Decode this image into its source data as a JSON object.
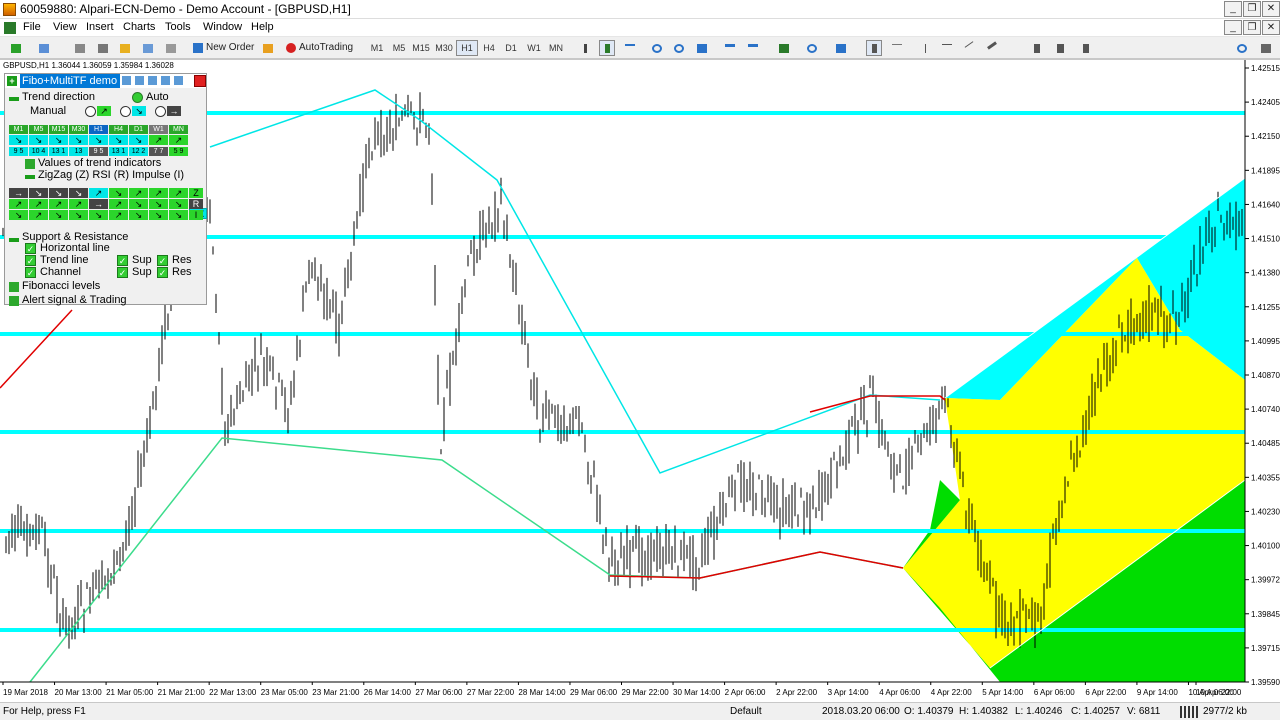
{
  "window": {
    "title": "60059880: Alpari-ECN-Demo - Demo Account - [GBPUSD,H1]"
  },
  "menu": [
    "File",
    "View",
    "Insert",
    "Charts",
    "Tools",
    "Window",
    "Help"
  ],
  "toolbar": {
    "new_order": "New Order",
    "auto_trading": "AutoTrading",
    "timeframes": [
      "M1",
      "M5",
      "M15",
      "M30",
      "H1",
      "H4",
      "D1",
      "W1",
      "MN"
    ],
    "active_timeframe": "H1"
  },
  "chart": {
    "symbol_line": "GBPUSD,H1  1.36044 1.36059 1.35984 1.36028",
    "price_labels": [
      "1.42515",
      "1.42405",
      "1.42150",
      "1.41895",
      "1.41640",
      "1.41510",
      "1.41380",
      "1.41255",
      "1.40995",
      "1.40870",
      "1.40740",
      "1.40485",
      "1.40355",
      "1.40230",
      "1.40100",
      "1.39972",
      "1.39845",
      "1.39715",
      "1.39590"
    ],
    "time_labels": [
      "19 Mar 2018",
      "20 Mar 13:00",
      "21 Mar 05:00",
      "21 Mar 21:00",
      "22 Mar 13:00",
      "23 Mar 05:00",
      "23 Mar 21:00",
      "26 Mar 14:00",
      "27 Mar 06:00",
      "27 Mar 22:00",
      "28 Mar 14:00",
      "29 Mar 06:00",
      "29 Mar 22:00",
      "30 Mar 14:00",
      "2 Apr 06:00",
      "2 Apr 22:00",
      "3 Apr 14:00",
      "4 Apr 06:00",
      "4 Apr 22:00",
      "5 Apr 14:00",
      "6 Apr 06:00",
      "6 Apr 22:00",
      "9 Apr 14:00",
      "10 Apr 06:00",
      "10 Apr 22:00"
    ],
    "colors": {
      "hline": "#00ffff",
      "zigzag": "#00e6e6",
      "support": "#3cdc8c",
      "resistance": "#e00000",
      "yellow": "#ffff00",
      "green": "#00dd00",
      "cyan": "#00ffff"
    }
  },
  "panel": {
    "title": "Fibo+MultiTF demo",
    "trend_direction": "Trend direction",
    "auto": "Auto",
    "manual": "Manual",
    "tf_labels": [
      "M1",
      "M5",
      "M15",
      "M30",
      "H1",
      "H4",
      "D1",
      "W1",
      "MN"
    ],
    "tf_numbers": [
      "9 5",
      "10 4",
      "13 1",
      "13",
      "9 5",
      "13 1",
      "12 2",
      "7 7",
      "5 9"
    ],
    "cx": "CX",
    "values_title": "Values of trend indicators",
    "indicators": "ZigZag (Z)  RSI (R)  Impulse (I)",
    "row_labels": [
      "Z",
      "R",
      "I"
    ],
    "sr_title": "Support & Resistance",
    "horizontal_line": "Horizontal line",
    "trend_line": "Trend line",
    "channel": "Channel",
    "sup": "Sup",
    "res": "Res",
    "fibonacci": "Fibonacci levels",
    "alert": "Alert signal & Trading"
  },
  "status": {
    "help": "For Help, press F1",
    "profile": "Default",
    "datetime": "2018.03.20 06:00",
    "open": "O: 1.40379",
    "high": "H: 1.40382",
    "low": "L: 1.40246",
    "close": "C: 1.40257",
    "volume": "V: 6811",
    "traffic": "2977/2 kb"
  }
}
